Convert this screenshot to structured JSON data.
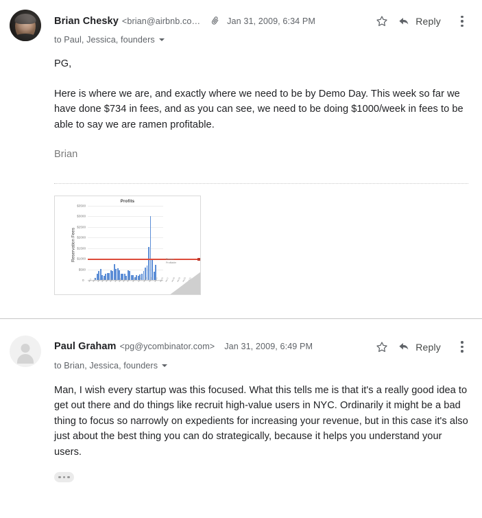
{
  "thread": {
    "messages": [
      {
        "sender_name": "Brian Chesky",
        "sender_email": "<brian@airbnb.co…",
        "date": "Jan 31, 2009, 6:34 PM",
        "recipients": "to Paul, Jessica, founders",
        "has_attachment": true,
        "avatar_type": "photo",
        "reply_label": "Reply",
        "body": {
          "greeting": "PG,",
          "paragraph": "Here is where we are, and exactly where we need to be by Demo Day. This week so far we have done $734 in fees, and as you can see, we need to be doing $1000/week in fees to be able to say we are ramen profitable.",
          "signature": "Brian"
        }
      },
      {
        "sender_name": "Paul Graham",
        "sender_email": "<pg@ycombinator.com>",
        "date": "Jan 31, 2009, 6:49 PM",
        "recipients": "to Brian, Jessica, founders",
        "has_attachment": false,
        "avatar_type": "generic",
        "reply_label": "Reply",
        "body": {
          "paragraph": "Man, I wish every startup was this focused.  What this tells me is that it's a really good idea to get out there and do things like recruit high-value users in NYC.  Ordinarily it might be a bad thing to focus so narrowly on expedients for increasing your revenue, but in this case it's also just about the best thing you can do strategically, because it helps you understand your users."
        }
      }
    ]
  },
  "icons": {
    "attachment": "paperclip-icon",
    "star": "star-icon",
    "reply": "reply-arrow-icon",
    "more": "kebab-menu-icon",
    "expand_recipients": "chevron-down-icon",
    "trimmed_content": "ellipsis-icon"
  },
  "colors": {
    "bar": "#5b8dd6",
    "threshold_line": "#dd4b39",
    "text_primary": "#202124",
    "text_secondary": "#5f6368"
  },
  "chart_data": {
    "type": "bar",
    "title": "Profits",
    "xlabel": "",
    "ylabel": "Reservation Fees",
    "ylim": [
      0,
      3500
    ],
    "yticks": [
      "$3500",
      "$3000",
      "$2500",
      "$2000",
      "$1500",
      "$1000",
      "$500",
      "0"
    ],
    "grid": true,
    "legend_position": "right",
    "annotations": [
      {
        "label": "Ramen\nProfitable",
        "type": "hline",
        "value": 1000,
        "color": "#dd4b39"
      }
    ],
    "categories": [
      "wk1",
      "wk2",
      "wk3",
      "wk4",
      "wk5",
      "wk6",
      "wk7",
      "wk8",
      "wk9",
      "wk10",
      "wk11",
      "wk12",
      "wk13",
      "wk14",
      "wk15",
      "wk16",
      "wk17",
      "wk18",
      "wk19",
      "wk20",
      "wk21",
      "wk22",
      "wk23",
      "wk24",
      "wk25",
      "wk26",
      "wk27",
      "wk28",
      "wk29",
      "wk30",
      "wk31",
      "wk32",
      "wk33",
      "wk34",
      "wk35",
      "wk36",
      "wk37",
      "wk38",
      "wk39",
      "wk40",
      "wk41",
      "wk42",
      "wk43",
      "wk44"
    ],
    "values": [
      0,
      0,
      0,
      0,
      110,
      300,
      430,
      530,
      250,
      210,
      300,
      340,
      330,
      480,
      420,
      760,
      520,
      560,
      480,
      300,
      290,
      300,
      210,
      470,
      430,
      250,
      230,
      160,
      250,
      200,
      260,
      300,
      450,
      600,
      680,
      1560,
      3010,
      1000,
      390,
      720,
      0,
      0,
      0,
      0
    ],
    "series": [
      {
        "name": "Reservation Fees",
        "color": "#5b8dd6"
      }
    ]
  }
}
